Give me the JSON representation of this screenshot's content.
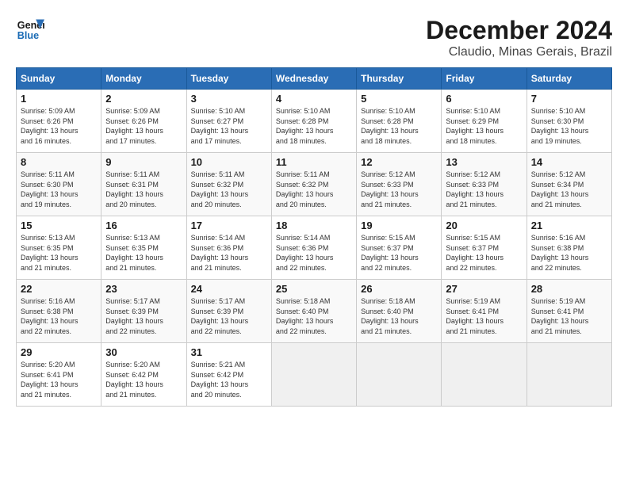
{
  "logo": {
    "line1": "General",
    "line2": "Blue"
  },
  "title": "December 2024",
  "location": "Claudio, Minas Gerais, Brazil",
  "days_of_week": [
    "Sunday",
    "Monday",
    "Tuesday",
    "Wednesday",
    "Thursday",
    "Friday",
    "Saturday"
  ],
  "weeks": [
    [
      {
        "day": "1",
        "info": "Sunrise: 5:09 AM\nSunset: 6:26 PM\nDaylight: 13 hours\nand 16 minutes."
      },
      {
        "day": "2",
        "info": "Sunrise: 5:09 AM\nSunset: 6:26 PM\nDaylight: 13 hours\nand 17 minutes."
      },
      {
        "day": "3",
        "info": "Sunrise: 5:10 AM\nSunset: 6:27 PM\nDaylight: 13 hours\nand 17 minutes."
      },
      {
        "day": "4",
        "info": "Sunrise: 5:10 AM\nSunset: 6:28 PM\nDaylight: 13 hours\nand 18 minutes."
      },
      {
        "day": "5",
        "info": "Sunrise: 5:10 AM\nSunset: 6:28 PM\nDaylight: 13 hours\nand 18 minutes."
      },
      {
        "day": "6",
        "info": "Sunrise: 5:10 AM\nSunset: 6:29 PM\nDaylight: 13 hours\nand 18 minutes."
      },
      {
        "day": "7",
        "info": "Sunrise: 5:10 AM\nSunset: 6:30 PM\nDaylight: 13 hours\nand 19 minutes."
      }
    ],
    [
      {
        "day": "8",
        "info": "Sunrise: 5:11 AM\nSunset: 6:30 PM\nDaylight: 13 hours\nand 19 minutes."
      },
      {
        "day": "9",
        "info": "Sunrise: 5:11 AM\nSunset: 6:31 PM\nDaylight: 13 hours\nand 20 minutes."
      },
      {
        "day": "10",
        "info": "Sunrise: 5:11 AM\nSunset: 6:32 PM\nDaylight: 13 hours\nand 20 minutes."
      },
      {
        "day": "11",
        "info": "Sunrise: 5:11 AM\nSunset: 6:32 PM\nDaylight: 13 hours\nand 20 minutes."
      },
      {
        "day": "12",
        "info": "Sunrise: 5:12 AM\nSunset: 6:33 PM\nDaylight: 13 hours\nand 21 minutes."
      },
      {
        "day": "13",
        "info": "Sunrise: 5:12 AM\nSunset: 6:33 PM\nDaylight: 13 hours\nand 21 minutes."
      },
      {
        "day": "14",
        "info": "Sunrise: 5:12 AM\nSunset: 6:34 PM\nDaylight: 13 hours\nand 21 minutes."
      }
    ],
    [
      {
        "day": "15",
        "info": "Sunrise: 5:13 AM\nSunset: 6:35 PM\nDaylight: 13 hours\nand 21 minutes."
      },
      {
        "day": "16",
        "info": "Sunrise: 5:13 AM\nSunset: 6:35 PM\nDaylight: 13 hours\nand 21 minutes."
      },
      {
        "day": "17",
        "info": "Sunrise: 5:14 AM\nSunset: 6:36 PM\nDaylight: 13 hours\nand 21 minutes."
      },
      {
        "day": "18",
        "info": "Sunrise: 5:14 AM\nSunset: 6:36 PM\nDaylight: 13 hours\nand 22 minutes."
      },
      {
        "day": "19",
        "info": "Sunrise: 5:15 AM\nSunset: 6:37 PM\nDaylight: 13 hours\nand 22 minutes."
      },
      {
        "day": "20",
        "info": "Sunrise: 5:15 AM\nSunset: 6:37 PM\nDaylight: 13 hours\nand 22 minutes."
      },
      {
        "day": "21",
        "info": "Sunrise: 5:16 AM\nSunset: 6:38 PM\nDaylight: 13 hours\nand 22 minutes."
      }
    ],
    [
      {
        "day": "22",
        "info": "Sunrise: 5:16 AM\nSunset: 6:38 PM\nDaylight: 13 hours\nand 22 minutes."
      },
      {
        "day": "23",
        "info": "Sunrise: 5:17 AM\nSunset: 6:39 PM\nDaylight: 13 hours\nand 22 minutes."
      },
      {
        "day": "24",
        "info": "Sunrise: 5:17 AM\nSunset: 6:39 PM\nDaylight: 13 hours\nand 22 minutes."
      },
      {
        "day": "25",
        "info": "Sunrise: 5:18 AM\nSunset: 6:40 PM\nDaylight: 13 hours\nand 22 minutes."
      },
      {
        "day": "26",
        "info": "Sunrise: 5:18 AM\nSunset: 6:40 PM\nDaylight: 13 hours\nand 21 minutes."
      },
      {
        "day": "27",
        "info": "Sunrise: 5:19 AM\nSunset: 6:41 PM\nDaylight: 13 hours\nand 21 minutes."
      },
      {
        "day": "28",
        "info": "Sunrise: 5:19 AM\nSunset: 6:41 PM\nDaylight: 13 hours\nand 21 minutes."
      }
    ],
    [
      {
        "day": "29",
        "info": "Sunrise: 5:20 AM\nSunset: 6:41 PM\nDaylight: 13 hours\nand 21 minutes."
      },
      {
        "day": "30",
        "info": "Sunrise: 5:20 AM\nSunset: 6:42 PM\nDaylight: 13 hours\nand 21 minutes."
      },
      {
        "day": "31",
        "info": "Sunrise: 5:21 AM\nSunset: 6:42 PM\nDaylight: 13 hours\nand 20 minutes."
      },
      {
        "day": "",
        "info": ""
      },
      {
        "day": "",
        "info": ""
      },
      {
        "day": "",
        "info": ""
      },
      {
        "day": "",
        "info": ""
      }
    ]
  ]
}
